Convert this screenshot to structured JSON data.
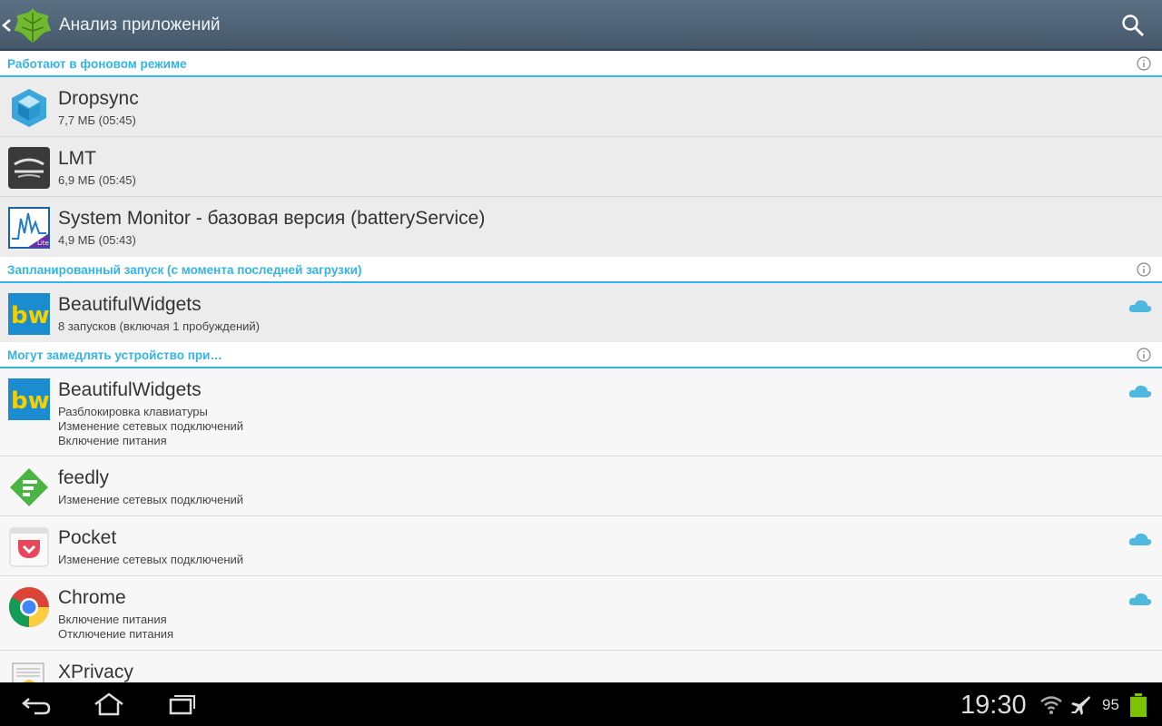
{
  "app": {
    "title": "Анализ приложений",
    "back_icon": "chevron-left-icon",
    "logo_icon": "greenify-leaf-icon",
    "search_icon": "search-icon"
  },
  "sections": [
    {
      "title": "Работают в фоновом режиме",
      "rows": [
        {
          "name": "Dropsync",
          "icon": "dropsync-icon",
          "lines": [
            "7,7 МБ (05:45)"
          ],
          "cloud": false
        },
        {
          "name": "LMT",
          "icon": "lmt-icon",
          "lines": [
            "6,9 МБ (05:45)"
          ],
          "cloud": false
        },
        {
          "name": "System Monitor - базовая версия (batteryService)",
          "icon": "system-monitor-lite-icon",
          "lines": [
            "4,9 МБ (05:43)"
          ],
          "cloud": false
        }
      ]
    },
    {
      "title": "Запланированный запуск (с момента последней загрузки)",
      "rows": [
        {
          "name": "BeautifulWidgets",
          "icon": "beautifulwidgets-icon",
          "lines": [
            "8 запусков (включая 1 пробуждений)"
          ],
          "cloud": true
        }
      ]
    },
    {
      "title": "Могут замедлять устройство при…",
      "rows": [
        {
          "name": "BeautifulWidgets",
          "icon": "beautifulwidgets-icon",
          "lines": [
            "Разблокировка клавиатуры",
            "Изменение сетевых подключений",
            "Включение питания"
          ],
          "cloud": true
        },
        {
          "name": "feedly",
          "icon": "feedly-icon",
          "lines": [
            "Изменение сетевых подключений"
          ],
          "cloud": false
        },
        {
          "name": "Pocket",
          "icon": "pocket-icon",
          "lines": [
            "Изменение сетевых подключений"
          ],
          "cloud": true
        },
        {
          "name": "Chrome",
          "icon": "chrome-icon",
          "lines": [
            "Включение питания",
            "Отключение питания"
          ],
          "cloud": true
        },
        {
          "name": "XPrivacy",
          "icon": "xprivacy-icon",
          "lines": [],
          "cloud": false
        }
      ]
    }
  ],
  "navbar": {
    "back_icon": "nav-back-icon",
    "home_icon": "nav-home-icon",
    "recents_icon": "nav-recents-icon",
    "time": "19:30",
    "wifi_icon": "wifi-icon",
    "airplane_icon": "airplane-icon",
    "battery_percent": "95",
    "battery_level": 0.95
  },
  "colors": {
    "accent": "#33b5e5",
    "actionbar": "#4f6476",
    "battery": "#7cc300"
  }
}
